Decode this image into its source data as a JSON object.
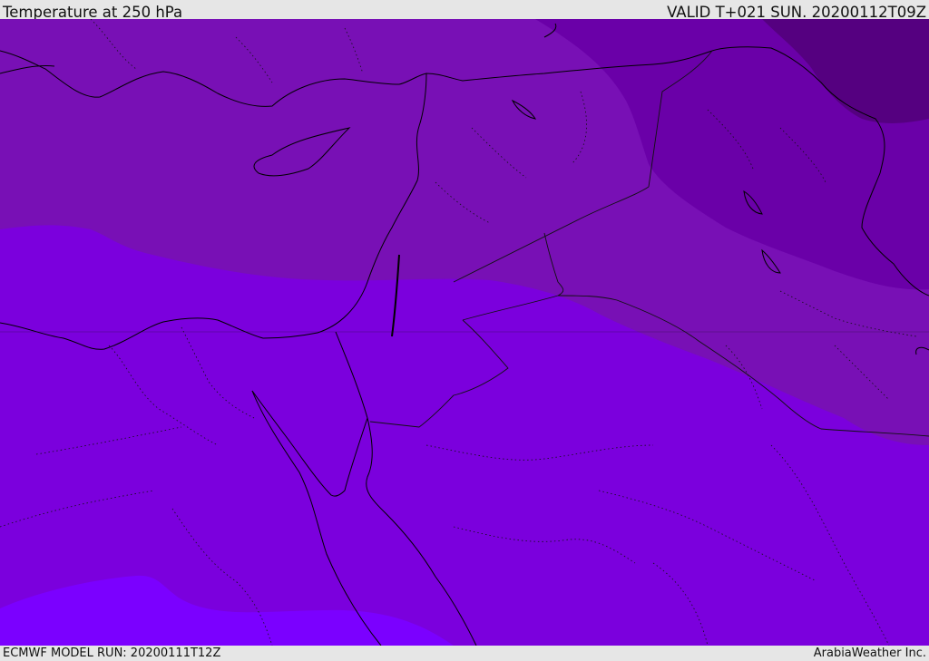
{
  "header": {
    "title": "Temperature at 250 hPa",
    "valid": "VALID T+021 SUN. 20200112T09Z"
  },
  "footer": {
    "model_run": "ECMWF MODEL RUN: 20200111T12Z",
    "credit": "ArabiaWeather Inc."
  },
  "colors": {
    "band_warmest": "#7b00ff",
    "band_warm": "#7b00dd",
    "band_mid": "#7810b5",
    "band_cool": "#6a00a8",
    "band_coldest": "#550080",
    "coastline": "#000000",
    "border": "#111111"
  }
}
